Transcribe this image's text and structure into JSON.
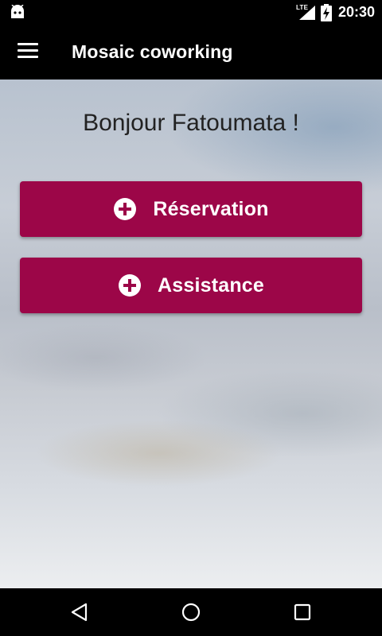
{
  "status_bar": {
    "network": "LTE",
    "time": "20:30",
    "icons": [
      "android-icon",
      "signal-icon",
      "battery-charging-icon"
    ]
  },
  "app_bar": {
    "title": "Mosaic coworking",
    "menu_icon": "hamburger-menu-icon"
  },
  "main": {
    "greeting": "Bonjour Fatoumata !",
    "buttons": [
      {
        "label": "Réservation",
        "icon": "plus-circle-icon"
      },
      {
        "label": "Assistance",
        "icon": "plus-circle-icon"
      }
    ]
  },
  "nav_bar": {
    "icons": [
      "back-icon",
      "home-icon",
      "recents-icon"
    ]
  },
  "colors": {
    "accent": "#9c0648",
    "app_bar": "#000000",
    "text_dark": "#222222"
  }
}
